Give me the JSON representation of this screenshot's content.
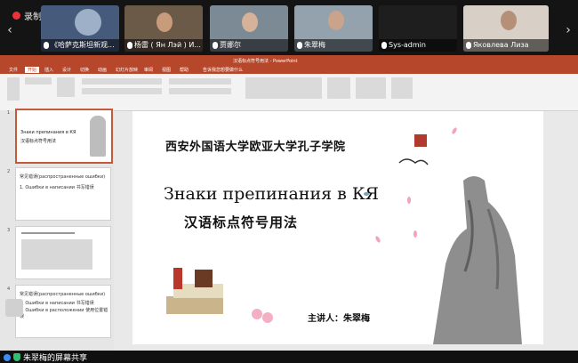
{
  "recording": {
    "label": "录制中"
  },
  "participants": [
    {
      "name": "《哈萨克斯坦新观...",
      "bg": "#4a5a78"
    },
    {
      "name": "杨雷 ( Ян Лэй ) И...",
      "bg": "#5b4a3a"
    },
    {
      "name": "贾娜尔",
      "bg": "#6a7a8a"
    },
    {
      "name": "朱翠梅",
      "bg": "#8a9aa6"
    },
    {
      "name": "Sys-admin",
      "bg": "#202020"
    },
    {
      "name": "Яковлева Лиза",
      "bg": "#d8d0c8"
    }
  ],
  "ppt": {
    "window_title": "汉语标点符号用法 - PowerPoint",
    "tabs": [
      "文件",
      "开始",
      "插入",
      "设计",
      "切换",
      "动画",
      "幻灯片放映",
      "审阅",
      "视图",
      "帮助"
    ],
    "active_tab": "开始",
    "tell_me": "告诉我您想要做什么"
  },
  "thumbnails": [
    {
      "num": "1",
      "text": "Знаки препинания в КЯ"
    },
    {
      "num": "2",
      "text": "常见错误(распространенные ошибки)"
    },
    {
      "num": "3",
      "text": ""
    },
    {
      "num": "4",
      "text": "常见错误(распространенные ошибки)"
    }
  ],
  "thumb_sub": {
    "t1_sub": "汉语标点符号用法",
    "t2_sub": "1. Ошибки в написании 书写错误",
    "t4_a": "1. Ошибки в написании 书写错误",
    "t4_b": "2. Ошибки в расположении 使用位置错误"
  },
  "slide": {
    "title_cn": "西安外国语大学欧亚大学孔子学院",
    "title_ru": "Знаки препинания в КЯ",
    "subtitle_cn": "汉语标点符号用法",
    "lecturer": "主讲人：朱翠梅"
  },
  "share": {
    "label": "朱翠梅的屏幕共享"
  }
}
